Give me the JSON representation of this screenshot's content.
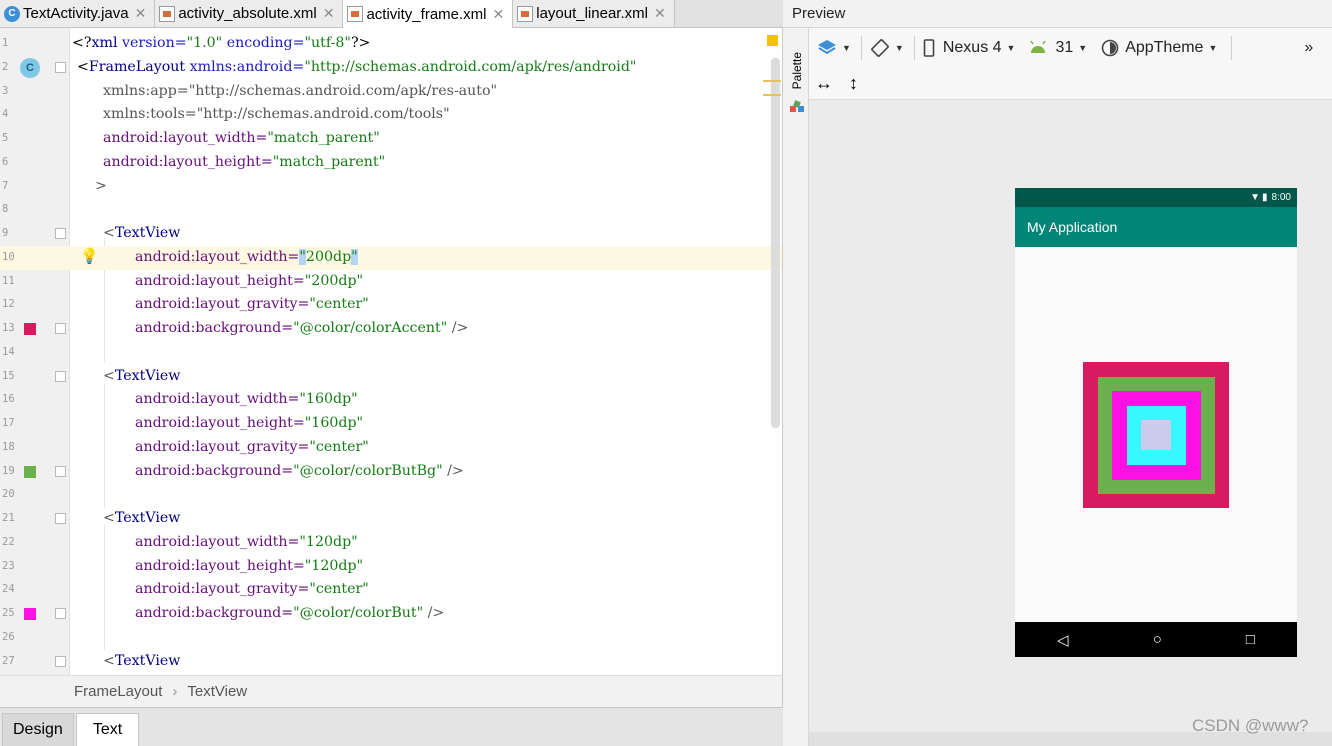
{
  "tabs": [
    {
      "label": "TextActivity.java",
      "icon": "java-class-icon",
      "active": false
    },
    {
      "label": "activity_absolute.xml",
      "icon": "xml-file-icon",
      "active": false
    },
    {
      "label": "activity_frame.xml",
      "icon": "xml-file-icon",
      "active": true
    },
    {
      "label": "layout_linear.xml",
      "icon": "xml-file-icon",
      "active": false
    }
  ],
  "editor": {
    "lines": [
      {
        "n": "1"
      },
      {
        "n": "2"
      },
      {
        "n": "3"
      },
      {
        "n": "4"
      },
      {
        "n": "5"
      },
      {
        "n": "6"
      },
      {
        "n": "7"
      },
      {
        "n": "8"
      },
      {
        "n": "9"
      },
      {
        "n": "10"
      },
      {
        "n": "11"
      },
      {
        "n": "12"
      },
      {
        "n": "13"
      },
      {
        "n": "14"
      },
      {
        "n": "15"
      },
      {
        "n": "16"
      },
      {
        "n": "17"
      },
      {
        "n": "18"
      },
      {
        "n": "19"
      },
      {
        "n": "20"
      },
      {
        "n": "21"
      },
      {
        "n": "22"
      },
      {
        "n": "23"
      },
      {
        "n": "24"
      },
      {
        "n": "25"
      },
      {
        "n": "26"
      },
      {
        "n": "27"
      }
    ],
    "xml_decl": {
      "open": "<?",
      "name": "xml",
      "version_attr": " version=",
      "version_val": "\"1.0\"",
      "encoding_attr": " encoding=",
      "encoding_val": "\"utf-8\"",
      "close": "?>"
    },
    "root": {
      "open": "<",
      "tag": "FrameLayout",
      "xmlns_android": " xmlns:android=",
      "xmlns_android_val": "\"http://schemas.android.com/apk/res/android\""
    },
    "line3": {
      "attr": "xmlns:app=",
      "val": "\"http://schemas.android.com/apk/res-auto\""
    },
    "line4": {
      "attr": "xmlns:tools=",
      "val": "\"http://schemas.android.com/tools\""
    },
    "line5": {
      "attr": "android:layout_width=",
      "val": "\"match_parent\""
    },
    "line6": {
      "attr": "android:layout_height=",
      "val": "\"match_parent\""
    },
    "line7": ">",
    "textview_open": "<",
    "textview_tag": "TextView",
    "attr_width": "android:layout_width=",
    "attr_height": "android:layout_height=",
    "attr_gravity": "android:layout_gravity=",
    "attr_bg": "android:background=",
    "self_close": " />",
    "views": [
      {
        "width": "\"200dp\"",
        "width_q1": "\"",
        "width_inner": "200dp",
        "width_q2": "\"",
        "height": "\"200dp\"",
        "gravity": "\"center\"",
        "background": "\"@color/colorAccent\"",
        "swatch": "#d81b60"
      },
      {
        "width": "\"160dp\"",
        "height": "\"160dp\"",
        "gravity": "\"center\"",
        "background": "\"@color/colorButBg\"",
        "swatch": "#6ab04c"
      },
      {
        "width": "\"120dp\"",
        "height": "\"120dp\"",
        "gravity": "\"center\"",
        "background": "\"@color/colorBut\"",
        "swatch": "#ff11e3"
      }
    ],
    "gutter_badge": "C"
  },
  "breadcrumb": [
    "FrameLayout",
    "TextView"
  ],
  "bottom_tabs": [
    {
      "label": "Design",
      "active": false
    },
    {
      "label": "Text",
      "active": true
    }
  ],
  "preview": {
    "title": "Preview",
    "palette_label": "Palette",
    "toolbar": {
      "layers_icon": "layers-icon",
      "orientation_icon": "rotate-icon",
      "device": "Nexus 4",
      "api": "31",
      "theme": "AppTheme",
      "more": "»"
    },
    "device": {
      "time": "8:00",
      "app_title": "My Application",
      "boxes": [
        {
          "color": "#d81b60"
        },
        {
          "color": "#6ab04c"
        },
        {
          "color": "#ff11e3"
        },
        {
          "color": "#37f8ff"
        },
        {
          "color": "#cccbeb"
        }
      ]
    }
  },
  "watermark": "CSDN @www?"
}
